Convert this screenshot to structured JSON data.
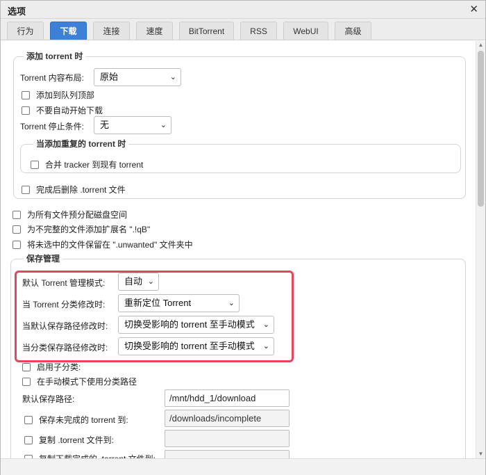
{
  "window": {
    "title": "选项",
    "close_glyph": "✕"
  },
  "tabs": [
    {
      "label": "行为"
    },
    {
      "label": "下载",
      "active": true
    },
    {
      "label": "连接"
    },
    {
      "label": "速度"
    },
    {
      "label": "BitTorrent"
    },
    {
      "label": "RSS"
    },
    {
      "label": "WebUI"
    },
    {
      "label": "高级"
    }
  ],
  "add_torrent": {
    "legend": "添加 torrent 时",
    "layout_label": "Torrent 内容布局:",
    "layout_value": "原始",
    "add_to_top_label": "添加到队列顶部",
    "dont_start_label": "不要自动开始下载",
    "stop_condition_label": "Torrent 停止条件:",
    "stop_condition_value": "无",
    "duplicate": {
      "legend": "当添加重复的 torrent 时",
      "merge_trackers_label": "合并 tracker 到现有 torrent"
    },
    "delete_torrent_file_label": "完成后删除 .torrent 文件"
  },
  "options": {
    "preallocate_label": "为所有文件预分配磁盘空间",
    "append_ext_label": "为不完整的文件添加扩展名 \".!qB\"",
    "unwanted_label": "将未选中的文件保留在 \".unwanted\" 文件夹中"
  },
  "saving": {
    "legend": "保存管理",
    "default_mode_label": "默认 Torrent 管理模式:",
    "default_mode_value": "自动",
    "category_changed_label": "当 Torrent 分类修改时:",
    "category_changed_value": "重新定位 Torrent",
    "default_path_changed_label": "当默认保存路径修改时:",
    "default_path_changed_value": "切换受影响的 torrent 至手动模式",
    "category_path_changed_label": "当分类保存路径修改时:",
    "category_path_changed_value": "切换受影响的 torrent 至手动模式",
    "subcategories_label": "启用子分类:",
    "use_category_paths_label": "在手动模式下使用分类路径",
    "default_save_path_label": "默认保存路径:",
    "default_save_path_value": "/mnt/hdd_1/download",
    "incomplete_label": "保存未完成的 torrent 到:",
    "incomplete_value": "/downloads/incomplete",
    "copy_torrent_label": "复制 .torrent 文件到:",
    "copy_torrent_value": "",
    "copy_finished_label": "复制下载完成的 .torrent 文件到:",
    "copy_finished_value": ""
  },
  "icons": {
    "chevron": "⌄",
    "scroll_up": "▲",
    "scroll_down": "▼"
  },
  "colors": {
    "active_tab": "#3c80d8",
    "highlight": "#e8445a"
  }
}
